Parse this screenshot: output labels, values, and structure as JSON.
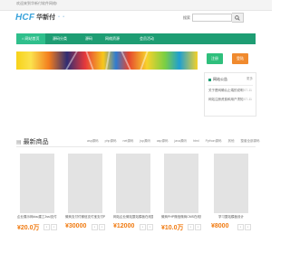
{
  "topbar": {
    "welcome": "欢迎来到华新付软件网络!"
  },
  "logo": {
    "mark": "HCF",
    "name": "华新付",
    "dots": "• •"
  },
  "search": {
    "label": "搜索",
    "placeholder": "",
    "icon": "search-icon"
  },
  "nav": {
    "items": [
      {
        "label": "网站首页"
      },
      {
        "label": "源码分类"
      },
      {
        "label": "源码"
      },
      {
        "label": "网络资源"
      },
      {
        "label": "会员活动"
      }
    ]
  },
  "auth": {
    "login": "注册",
    "register": "登陆"
  },
  "notice": {
    "title": "网站公告",
    "more": "更多",
    "items": [
      {
        "text": "关于是网确认止端的说明",
        "date": "07-11"
      },
      {
        "text": "网站注册资费和用户须知",
        "date": "07-11"
      }
    ]
  },
  "section": {
    "title": "最新商品",
    "tags": [
      "asp源码",
      "php源码",
      "net源码",
      "jsp源码",
      "asp源码",
      "java源码",
      "html",
      "Python源码",
      "其他",
      "整套全部源码"
    ]
  },
  "products": [
    {
      "title": "企业展示网dou建工2ssl支付平台",
      "price": "¥20.0万"
    },
    {
      "title": "微商支付付微信支付宝支付PHP源码",
      "price": "¥30000"
    },
    {
      "title": "网站企业微站整站模板在线整站模板",
      "price": "¥12000"
    },
    {
      "title": "微商PHP微信微商CMS在线管理系统",
      "price": "¥10.0万"
    },
    {
      "title": "学习整站模板设计",
      "price": "¥8000"
    }
  ]
}
